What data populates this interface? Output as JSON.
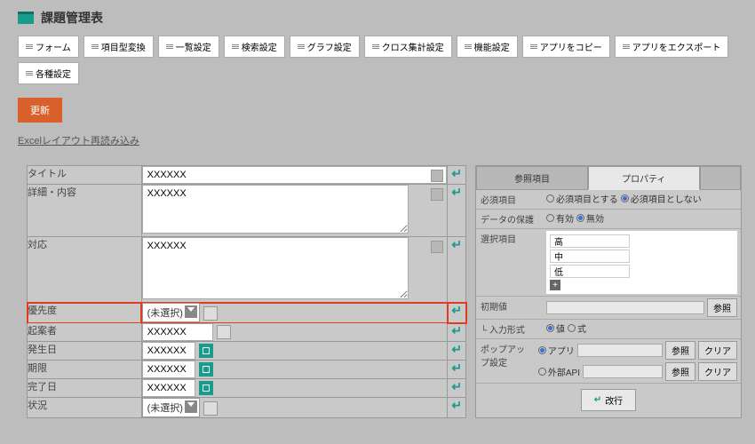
{
  "app_title": "課題管理表",
  "toolbar": [
    "フォーム",
    "項目型変換",
    "一覧設定",
    "検索設定",
    "グラフ設定",
    "クロス集計設定",
    "機能設定",
    "アプリをコピー",
    "アプリをエクスポート",
    "各種設定"
  ],
  "update_btn": "更新",
  "excel_link": "Excelレイアウト再読み込み",
  "fields": {
    "title": {
      "label": "タイトル",
      "value": "XXXXXX"
    },
    "detail": {
      "label": "詳細・内容",
      "value": "XXXXXX"
    },
    "response": {
      "label": "対応",
      "value": "XXXXXX"
    },
    "priority": {
      "label": "優先度",
      "value": "(未選択)"
    },
    "creator": {
      "label": "起案者",
      "value": "XXXXXX"
    },
    "occur_date": {
      "label": "発生日",
      "value": "XXXXXX"
    },
    "deadline": {
      "label": "期限",
      "value": "XXXXXX"
    },
    "done_date": {
      "label": "完了日",
      "value": "XXXXXX"
    },
    "status": {
      "label": "状況",
      "value": "(未選択)"
    }
  },
  "props": {
    "tab_ref": "参照項目",
    "tab_prop": "プロパティ",
    "required": {
      "label": "必須項目",
      "opt1": "必須項目とする",
      "opt2": "必須項目としない"
    },
    "protect": {
      "label": "データの保護",
      "opt1": "有効",
      "opt2": "無効"
    },
    "options": {
      "label": "選択項目",
      "items": [
        "高",
        "中",
        "低"
      ]
    },
    "initial": {
      "label": "初期値",
      "ref_btn": "参照"
    },
    "input_type": {
      "label": "└ 入力形式",
      "opt1": "値",
      "opt2": "式"
    },
    "popup": {
      "label": "ポップアップ設定",
      "opt1": "アプリ",
      "opt2": "外部API",
      "ref_btn": "参照",
      "clear_btn": "クリア"
    },
    "newline_btn": "改行"
  }
}
